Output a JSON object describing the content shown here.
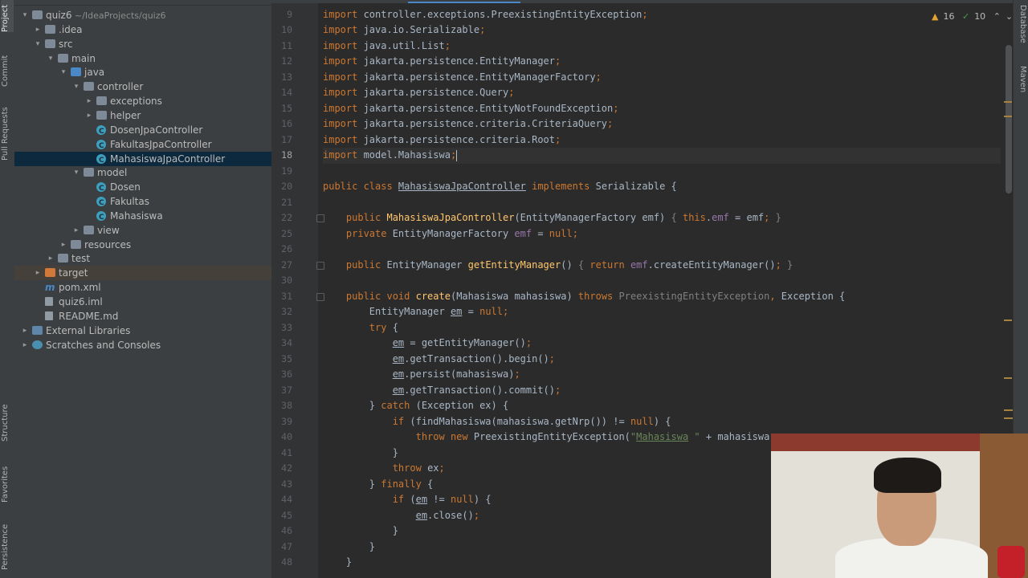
{
  "left_strip": {
    "tabs": [
      "Project",
      "Commit",
      "Pull Requests",
      "Structure",
      "Favorites",
      "Persistence"
    ]
  },
  "right_strip": {
    "tabs": [
      "Database",
      "Maven"
    ]
  },
  "project_tree": {
    "root_label": "quiz6",
    "root_path": "~/IdeaProjects/quiz6",
    "items": [
      {
        "label": "quiz6",
        "path": "~/IdeaProjects/quiz6",
        "depth": 0,
        "arrow": "▾",
        "icon": "folder"
      },
      {
        "label": ".idea",
        "depth": 1,
        "arrow": "▸",
        "icon": "folder"
      },
      {
        "label": "src",
        "depth": 1,
        "arrow": "▾",
        "icon": "folder"
      },
      {
        "label": "main",
        "depth": 2,
        "arrow": "▾",
        "icon": "folder"
      },
      {
        "label": "java",
        "depth": 3,
        "arrow": "▾",
        "icon": "folder-blue"
      },
      {
        "label": "controller",
        "depth": 4,
        "arrow": "▾",
        "icon": "folder"
      },
      {
        "label": "exceptions",
        "depth": 5,
        "arrow": "▸",
        "icon": "folder"
      },
      {
        "label": "helper",
        "depth": 5,
        "arrow": "▸",
        "icon": "folder"
      },
      {
        "label": "DosenJpaController",
        "depth": 5,
        "arrow": "",
        "icon": "class"
      },
      {
        "label": "FakultasJpaController",
        "depth": 5,
        "arrow": "",
        "icon": "class"
      },
      {
        "label": "MahasiswaJpaController",
        "depth": 5,
        "arrow": "",
        "icon": "class",
        "selected": true
      },
      {
        "label": "model",
        "depth": 4,
        "arrow": "▾",
        "icon": "folder"
      },
      {
        "label": "Dosen",
        "depth": 5,
        "arrow": "",
        "icon": "class"
      },
      {
        "label": "Fakultas",
        "depth": 5,
        "arrow": "",
        "icon": "class"
      },
      {
        "label": "Mahasiswa",
        "depth": 5,
        "arrow": "",
        "icon": "class"
      },
      {
        "label": "view",
        "depth": 4,
        "arrow": "▸",
        "icon": "folder"
      },
      {
        "label": "resources",
        "depth": 3,
        "arrow": "▸",
        "icon": "folder"
      },
      {
        "label": "test",
        "depth": 2,
        "arrow": "▸",
        "icon": "folder"
      },
      {
        "label": "target",
        "depth": 1,
        "arrow": "▸",
        "icon": "folder-orange",
        "target": true
      },
      {
        "label": "pom.xml",
        "depth": 1,
        "arrow": "",
        "icon": "maven"
      },
      {
        "label": "quiz6.iml",
        "depth": 1,
        "arrow": "",
        "icon": "file"
      },
      {
        "label": "README.md",
        "depth": 1,
        "arrow": "",
        "icon": "file"
      },
      {
        "label": "External Libraries",
        "depth": 0,
        "arrow": "▸",
        "icon": "libs"
      },
      {
        "label": "Scratches and Consoles",
        "depth": 0,
        "arrow": "▸",
        "icon": "scratch"
      }
    ]
  },
  "inspection": {
    "warnings": "16",
    "ok": "10"
  },
  "editor": {
    "current_line": "18",
    "line_numbers": [
      "9",
      "10",
      "11",
      "12",
      "13",
      "14",
      "15",
      "16",
      "17",
      "18",
      "19",
      "20",
      "21",
      "22",
      "25",
      "26",
      "27",
      "30",
      "31",
      "32",
      "33",
      "34",
      "35",
      "36",
      "37",
      "38",
      "39",
      "40",
      "41",
      "42",
      "43",
      "44",
      "45",
      "46",
      "47",
      "48"
    ],
    "fold_lines": [
      "22",
      "27",
      "31"
    ],
    "lines": [
      [
        {
          "t": "kw",
          "s": "import "
        },
        {
          "t": "",
          "s": "controller.exceptions.PreexistingEntityException"
        },
        {
          "t": "kw",
          "s": ";"
        }
      ],
      [
        {
          "t": "kw",
          "s": "import "
        },
        {
          "t": "",
          "s": "java.io.Serializable"
        },
        {
          "t": "kw",
          "s": ";"
        }
      ],
      [
        {
          "t": "kw",
          "s": "import "
        },
        {
          "t": "",
          "s": "java.util.List"
        },
        {
          "t": "kw",
          "s": ";"
        }
      ],
      [
        {
          "t": "kw",
          "s": "import "
        },
        {
          "t": "",
          "s": "jakarta.persistence.EntityManager"
        },
        {
          "t": "kw",
          "s": ";"
        }
      ],
      [
        {
          "t": "kw",
          "s": "import "
        },
        {
          "t": "",
          "s": "jakarta.persistence.EntityManagerFactory"
        },
        {
          "t": "kw",
          "s": ";"
        }
      ],
      [
        {
          "t": "kw",
          "s": "import "
        },
        {
          "t": "",
          "s": "jakarta.persistence.Query"
        },
        {
          "t": "kw",
          "s": ";"
        }
      ],
      [
        {
          "t": "kw",
          "s": "import "
        },
        {
          "t": "",
          "s": "jakarta.persistence.EntityNotFoundException"
        },
        {
          "t": "kw",
          "s": ";"
        }
      ],
      [
        {
          "t": "kw",
          "s": "import "
        },
        {
          "t": "",
          "s": "jakarta.persistence.criteria.CriteriaQuery"
        },
        {
          "t": "kw",
          "s": ";"
        }
      ],
      [
        {
          "t": "kw",
          "s": "import "
        },
        {
          "t": "",
          "s": "jakarta.persistence.criteria.Root"
        },
        {
          "t": "kw",
          "s": ";"
        }
      ],
      [
        {
          "t": "kw",
          "s": "import "
        },
        {
          "t": "",
          "s": "model.Mahasiswa"
        },
        {
          "t": "kw",
          "s": ";"
        },
        {
          "t": "caret",
          "s": ""
        }
      ],
      [],
      [
        {
          "t": "kw",
          "s": "public class "
        },
        {
          "t": "und",
          "s": "MahasiswaJpaController"
        },
        {
          "t": "",
          "s": " "
        },
        {
          "t": "kw",
          "s": "implements "
        },
        {
          "t": "",
          "s": "Serializable {"
        }
      ],
      [],
      [
        {
          "t": "",
          "s": "    "
        },
        {
          "t": "kw",
          "s": "public "
        },
        {
          "t": "fn",
          "s": "MahasiswaJpaController"
        },
        {
          "t": "",
          "s": "(EntityManagerFactory emf) "
        },
        {
          "t": "gray",
          "s": "{ "
        },
        {
          "t": "kw",
          "s": "this"
        },
        {
          "t": "",
          "s": "."
        },
        {
          "t": "fld",
          "s": "emf"
        },
        {
          "t": "",
          "s": " = emf"
        },
        {
          "t": "kw",
          "s": "; "
        },
        {
          "t": "gray",
          "s": "}"
        }
      ],
      [
        {
          "t": "",
          "s": "    "
        },
        {
          "t": "kw",
          "s": "private "
        },
        {
          "t": "",
          "s": "EntityManagerFactory "
        },
        {
          "t": "fld",
          "s": "emf"
        },
        {
          "t": "",
          "s": " = "
        },
        {
          "t": "kw",
          "s": "null;"
        }
      ],
      [],
      [
        {
          "t": "",
          "s": "    "
        },
        {
          "t": "kw",
          "s": "public "
        },
        {
          "t": "",
          "s": "EntityManager "
        },
        {
          "t": "fn",
          "s": "getEntityManager"
        },
        {
          "t": "",
          "s": "() "
        },
        {
          "t": "gray",
          "s": "{ "
        },
        {
          "t": "kw",
          "s": "return "
        },
        {
          "t": "fld",
          "s": "emf"
        },
        {
          "t": "",
          "s": ".createEntityManager()"
        },
        {
          "t": "kw",
          "s": "; "
        },
        {
          "t": "gray",
          "s": "}"
        }
      ],
      [],
      [
        {
          "t": "",
          "s": "    "
        },
        {
          "t": "kw",
          "s": "public void "
        },
        {
          "t": "fn",
          "s": "create"
        },
        {
          "t": "",
          "s": "(Mahasiswa mahasiswa) "
        },
        {
          "t": "kw",
          "s": "throws "
        },
        {
          "t": "gray",
          "s": "PreexistingEntityException"
        },
        {
          "t": "kw",
          "s": ", "
        },
        {
          "t": "",
          "s": "Exception {"
        }
      ],
      [
        {
          "t": "",
          "s": "        EntityManager "
        },
        {
          "t": "und2",
          "s": "em"
        },
        {
          "t": "",
          "s": " = "
        },
        {
          "t": "kw",
          "s": "null;"
        }
      ],
      [
        {
          "t": "",
          "s": "        "
        },
        {
          "t": "kw",
          "s": "try "
        },
        {
          "t": "",
          "s": "{"
        }
      ],
      [
        {
          "t": "",
          "s": "            "
        },
        {
          "t": "und2",
          "s": "em"
        },
        {
          "t": "",
          "s": " = getEntityManager()"
        },
        {
          "t": "kw",
          "s": ";"
        }
      ],
      [
        {
          "t": "",
          "s": "            "
        },
        {
          "t": "und2",
          "s": "em"
        },
        {
          "t": "",
          "s": ".getTransaction().begin()"
        },
        {
          "t": "kw",
          "s": ";"
        }
      ],
      [
        {
          "t": "",
          "s": "            "
        },
        {
          "t": "und2",
          "s": "em"
        },
        {
          "t": "",
          "s": ".persist(mahasiswa)"
        },
        {
          "t": "kw",
          "s": ";"
        }
      ],
      [
        {
          "t": "",
          "s": "            "
        },
        {
          "t": "und2",
          "s": "em"
        },
        {
          "t": "",
          "s": ".getTransaction().commit()"
        },
        {
          "t": "kw",
          "s": ";"
        }
      ],
      [
        {
          "t": "",
          "s": "        } "
        },
        {
          "t": "kw",
          "s": "catch "
        },
        {
          "t": "",
          "s": "(Exception ex) {"
        }
      ],
      [
        {
          "t": "",
          "s": "            "
        },
        {
          "t": "kw",
          "s": "if "
        },
        {
          "t": "",
          "s": "(findMahasiswa(mahasiswa.getNrp()) != "
        },
        {
          "t": "kw",
          "s": "null"
        },
        {
          "t": "",
          "s": ") {"
        }
      ],
      [
        {
          "t": "",
          "s": "                "
        },
        {
          "t": "kw",
          "s": "throw new "
        },
        {
          "t": "",
          "s": "PreexistingEntityException("
        },
        {
          "t": "str",
          "s": "\""
        },
        {
          "t": "strund",
          "s": "Mahasiswa"
        },
        {
          "t": "str",
          "s": " \""
        },
        {
          "t": "",
          "s": " + mahasiswa + "
        }
      ],
      [
        {
          "t": "",
          "s": "            }"
        }
      ],
      [
        {
          "t": "",
          "s": "            "
        },
        {
          "t": "kw",
          "s": "throw "
        },
        {
          "t": "",
          "s": "ex"
        },
        {
          "t": "kw",
          "s": ";"
        }
      ],
      [
        {
          "t": "",
          "s": "        } "
        },
        {
          "t": "kw",
          "s": "finally "
        },
        {
          "t": "",
          "s": "{"
        }
      ],
      [
        {
          "t": "",
          "s": "            "
        },
        {
          "t": "kw",
          "s": "if "
        },
        {
          "t": "",
          "s": "("
        },
        {
          "t": "und2",
          "s": "em"
        },
        {
          "t": "",
          "s": " != "
        },
        {
          "t": "kw",
          "s": "null"
        },
        {
          "t": "",
          "s": ") {"
        }
      ],
      [
        {
          "t": "",
          "s": "                "
        },
        {
          "t": "und2",
          "s": "em"
        },
        {
          "t": "",
          "s": ".close()"
        },
        {
          "t": "kw",
          "s": ";"
        }
      ],
      [
        {
          "t": "",
          "s": "            }"
        }
      ],
      [
        {
          "t": "",
          "s": "        }"
        }
      ],
      [
        {
          "t": "",
          "s": "    }"
        }
      ]
    ]
  },
  "colors": {
    "editor_bg": "#2b2b2b",
    "keyword": "#cc7832",
    "method": "#ffc66d",
    "field": "#9876aa",
    "string": "#6a8759",
    "selection": "#0d293e"
  }
}
